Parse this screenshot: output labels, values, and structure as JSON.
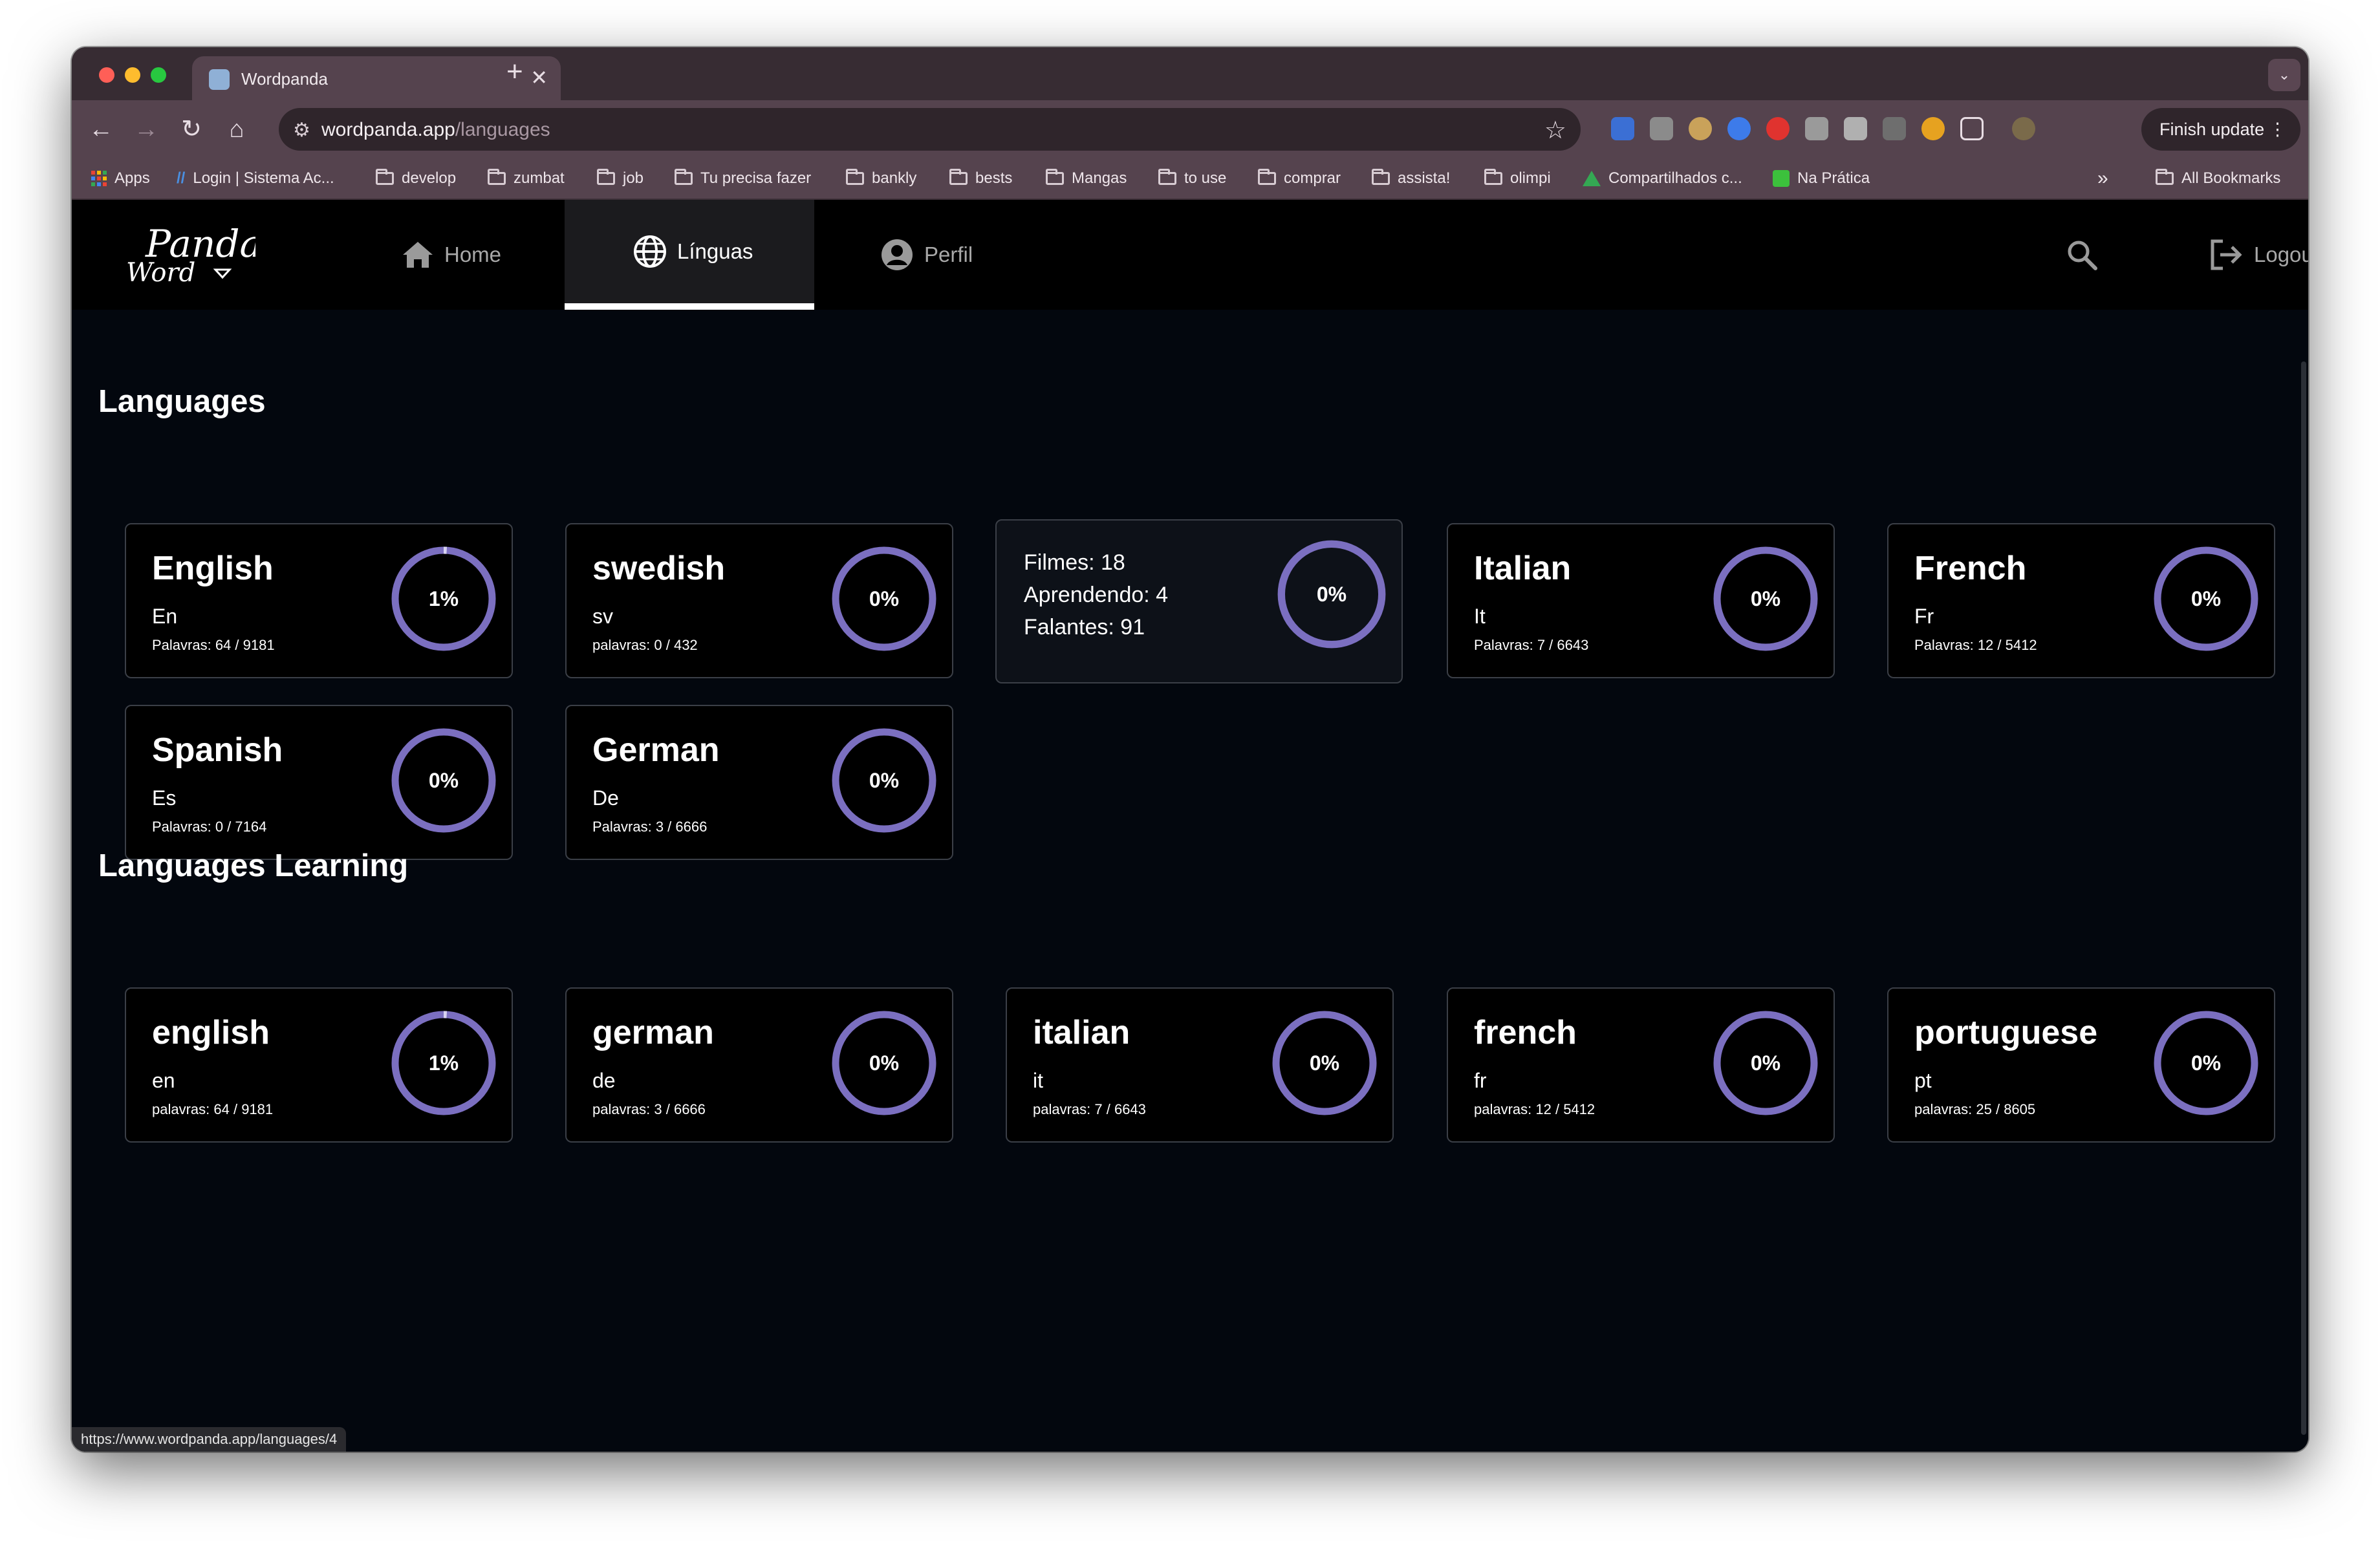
{
  "browser": {
    "tab_title": "Wordpanda",
    "url_host": "wordpanda.app",
    "url_path": "/languages",
    "finish_update_label": "Finish update",
    "status_url": "https://www.wordpanda.app/languages/4",
    "colors": {
      "frame": "#372c33",
      "toolbar": "#55434e",
      "omnibox": "#2f252b"
    }
  },
  "bookmarks": {
    "items": [
      {
        "label": "Apps",
        "icon": "apps-grid-icon"
      },
      {
        "label": "Login | Sistema Ac...",
        "icon": "slashes-icon"
      },
      {
        "label": "develop",
        "icon": "folder-icon"
      },
      {
        "label": "zumbat",
        "icon": "folder-icon"
      },
      {
        "label": "job",
        "icon": "folder-icon"
      },
      {
        "label": "Tu precisa fazer",
        "icon": "folder-icon"
      },
      {
        "label": "bankly",
        "icon": "folder-icon"
      },
      {
        "label": "bests",
        "icon": "folder-icon"
      },
      {
        "label": "Mangas",
        "icon": "folder-icon"
      },
      {
        "label": "to use",
        "icon": "folder-icon"
      },
      {
        "label": "comprar",
        "icon": "folder-icon"
      },
      {
        "label": "assista!",
        "icon": "folder-icon"
      },
      {
        "label": "olimpi",
        "icon": "folder-icon"
      },
      {
        "label": "Compartilhados c...",
        "icon": "google-drive-icon"
      },
      {
        "label": "Na Prática",
        "icon": "na-pratica-icon"
      }
    ],
    "overflow": "»",
    "all_bookmarks": "All Bookmarks"
  },
  "nav": {
    "logo_text_top": "Panda",
    "logo_text_bottom": "Word",
    "home": "Home",
    "languages": "Línguas",
    "profile": "Perfil",
    "logout": "Logout",
    "active": "languages"
  },
  "sections": {
    "languages_title": "Languages",
    "learning_title": "Languages Learning"
  },
  "languages": [
    {
      "name": "English",
      "code": "En",
      "words": "Palavras: 64 / 9181",
      "percent_label": "1%",
      "progress": 0.01
    },
    {
      "name": "swedish",
      "code": "sv",
      "words": "palavras: 0 / 432",
      "percent_label": "0%",
      "progress": 0
    },
    {
      "name": "",
      "hover_stats": [
        "Filmes: 18",
        "Aprendendo: 4",
        "Falantes: 91"
      ],
      "percent_label": "0%",
      "progress": 0
    },
    {
      "name": "Italian",
      "code": "It",
      "words": "Palavras: 7 / 6643",
      "percent_label": "0%",
      "progress": 0
    },
    {
      "name": "French",
      "code": "Fr",
      "words": "Palavras: 12 / 5412",
      "percent_label": "0%",
      "progress": 0
    },
    {
      "name": "Spanish",
      "code": "Es",
      "words": "Palavras: 0 / 7164",
      "percent_label": "0%",
      "progress": 0
    },
    {
      "name": "German",
      "code": "De",
      "words": "Palavras: 3 / 6666",
      "percent_label": "0%",
      "progress": 0
    }
  ],
  "learning": [
    {
      "name": "english",
      "code": "en",
      "words": "palavras: 64 / 9181",
      "percent_label": "1%",
      "progress": 0.01
    },
    {
      "name": "german",
      "code": "de",
      "words": "palavras: 3 / 6666",
      "percent_label": "0%",
      "progress": 0
    },
    {
      "name": "italian",
      "code": "it",
      "words": "palavras: 7 / 6643",
      "percent_label": "0%",
      "progress": 0
    },
    {
      "name": "french",
      "code": "fr",
      "words": "palavras: 12 / 5412",
      "percent_label": "0%",
      "progress": 0
    },
    {
      "name": "portuguese",
      "code": "pt",
      "words": "palavras: 25 / 8605",
      "percent_label": "0%",
      "progress": 0
    }
  ],
  "colors": {
    "ring": "#7b6fc0",
    "ring_accent": "#d8d3f2",
    "card_border": "#3b3f47",
    "background": "#03070e"
  }
}
